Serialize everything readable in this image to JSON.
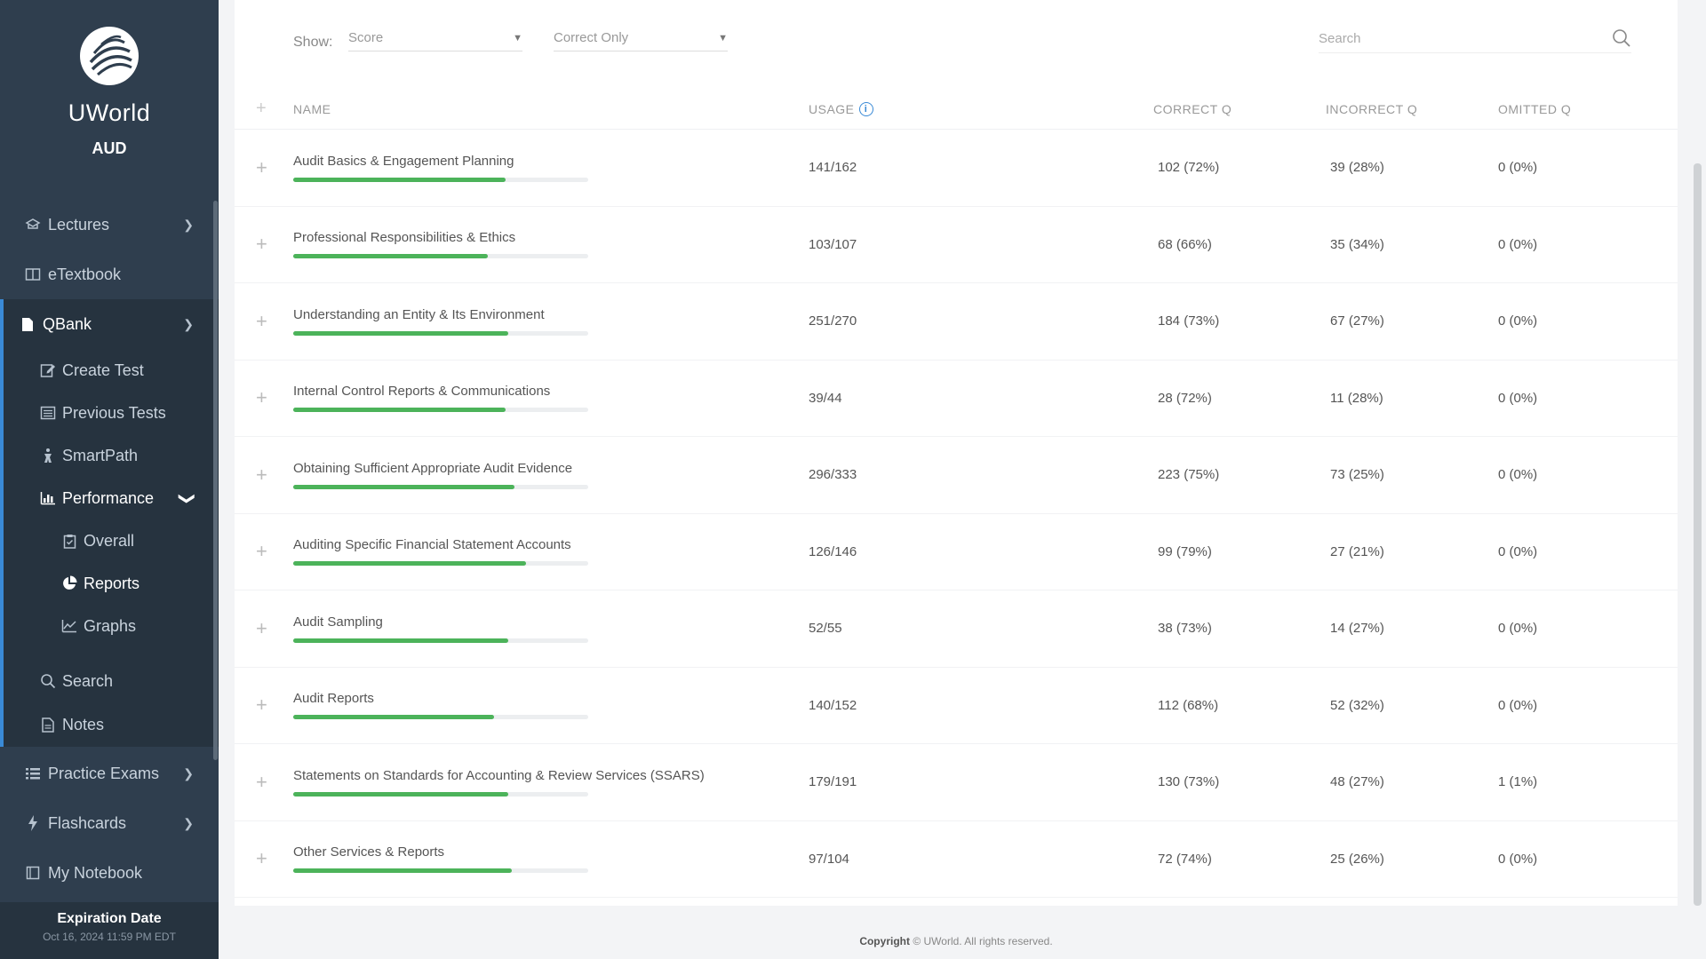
{
  "brand": {
    "name": "UWorld",
    "exam": "AUD"
  },
  "sidebar": {
    "lectures": "Lectures",
    "etextbook": "eTextbook",
    "qbank": "QBank",
    "create_test": "Create Test",
    "previous_tests": "Previous Tests",
    "smartpath": "SmartPath",
    "performance": "Performance",
    "overall": "Overall",
    "reports": "Reports",
    "graphs": "Graphs",
    "search": "Search",
    "notes": "Notes",
    "practice_exams": "Practice Exams",
    "flashcards": "Flashcards",
    "my_notebook": "My Notebook"
  },
  "expiry": {
    "title": "Expiration Date",
    "date": "Oct 16, 2024 11:59 PM EDT"
  },
  "toolbar": {
    "show_label": "Show:",
    "select1": "Score",
    "select2": "Correct Only",
    "search_placeholder": "Search"
  },
  "table": {
    "headers": {
      "name": "NAME",
      "usage": "USAGE",
      "correct": "CORRECT Q",
      "incorrect": "INCORRECT Q",
      "omitted": "OMITTED Q"
    },
    "rows": [
      {
        "name": "Audit Basics & Engagement Planning",
        "usage": "141/162",
        "correct": "102 (72%)",
        "incorrect": "39 (28%)",
        "omitted": "0 (0%)",
        "pct": 72
      },
      {
        "name": "Professional Responsibilities & Ethics",
        "usage": "103/107",
        "correct": "68 (66%)",
        "incorrect": "35 (34%)",
        "omitted": "0 (0%)",
        "pct": 66
      },
      {
        "name": "Understanding an Entity & Its Environment",
        "usage": "251/270",
        "correct": "184 (73%)",
        "incorrect": "67 (27%)",
        "omitted": "0 (0%)",
        "pct": 73
      },
      {
        "name": "Internal Control Reports & Communications",
        "usage": "39/44",
        "correct": "28 (72%)",
        "incorrect": "11 (28%)",
        "omitted": "0 (0%)",
        "pct": 72
      },
      {
        "name": "Obtaining Sufficient Appropriate Audit Evidence",
        "usage": "296/333",
        "correct": "223 (75%)",
        "incorrect": "73 (25%)",
        "omitted": "0 (0%)",
        "pct": 75
      },
      {
        "name": "Auditing Specific Financial Statement Accounts",
        "usage": "126/146",
        "correct": "99 (79%)",
        "incorrect": "27 (21%)",
        "omitted": "0 (0%)",
        "pct": 79
      },
      {
        "name": "Audit Sampling",
        "usage": "52/55",
        "correct": "38 (73%)",
        "incorrect": "14 (27%)",
        "omitted": "0 (0%)",
        "pct": 73
      },
      {
        "name": "Audit Reports",
        "usage": "140/152",
        "correct": "112 (68%)",
        "incorrect": "52 (32%)",
        "omitted": "0 (0%)",
        "pct": 68
      },
      {
        "name": "Statements on Standards for Accounting & Review Services (SSARS)",
        "usage": "179/191",
        "correct": "130 (73%)",
        "incorrect": "48 (27%)",
        "omitted": "1 (1%)",
        "pct": 73
      },
      {
        "name": "Other Services & Reports",
        "usage": "97/104",
        "correct": "72 (74%)",
        "incorrect": "25 (26%)",
        "omitted": "0 (0%)",
        "pct": 74
      }
    ]
  },
  "footer": {
    "bold": "Copyright",
    "text": "© UWorld. All rights reserved."
  },
  "colors": {
    "sidebar_bg": "#2f3e4e",
    "accent": "#3a8ad6",
    "progress": "#4cb35a"
  }
}
